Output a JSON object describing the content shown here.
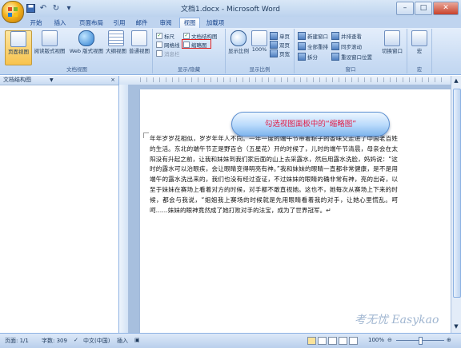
{
  "window": {
    "title": "文档1.docx - Microsoft Word"
  },
  "qat": {
    "save_icon": "save-icon",
    "undo_icon": "undo-icon",
    "redo_icon": "redo-icon",
    "customize": "▾"
  },
  "tabs": [
    {
      "label": "开始",
      "active": false
    },
    {
      "label": "插入",
      "active": false
    },
    {
      "label": "页面布局",
      "active": false
    },
    {
      "label": "引用",
      "active": false
    },
    {
      "label": "邮件",
      "active": false
    },
    {
      "label": "审阅",
      "active": false
    },
    {
      "label": "视图",
      "active": true
    },
    {
      "label": "加载项",
      "active": false
    }
  ],
  "ribbon": {
    "doc_views": {
      "label": "文档视图",
      "buttons": [
        "页面视图",
        "阅读版式视图",
        "Web 版式视图",
        "大纲视图",
        "普通视图"
      ],
      "selected": "页面视图"
    },
    "show_hide": {
      "label": "显示/隐藏",
      "ruler": {
        "label": "标尺",
        "checked": true
      },
      "gridlines": {
        "label": "网格线",
        "checked": false
      },
      "message_bar": {
        "label": "消息栏",
        "checked": false
      },
      "doc_map": {
        "label": "文档结构图",
        "checked": true
      },
      "thumbnails": {
        "label": "缩略图",
        "checked": false
      }
    },
    "zoom": {
      "label": "显示比例",
      "zoom_btn": "显示比例",
      "percent_btn": "100%",
      "one_page": "单页",
      "two_pages": "双页",
      "page_width": "页宽"
    },
    "window": {
      "label": "窗口",
      "new_window": "新建窗口",
      "arrange_all": "全部重排",
      "split": "拆分",
      "side_by_side": "并排查看",
      "sync_scroll": "同步滚动",
      "reset_position": "重设窗口位置",
      "switch_windows": "切换窗口"
    },
    "macros": {
      "label": "宏",
      "button": "宏"
    }
  },
  "map_pane": {
    "title": "文档结构图",
    "close": "×"
  },
  "callout": {
    "text": "勾选视图面板中的“缩略图”"
  },
  "document": {
    "body": "年年岁岁花相似，岁岁年年人不同。一年一度的端午节带着粽子的香味又走进了中国老百姓的生活。东北的端午节正是野百合（五星花）开的时候了，儿时的端午节清晨，母亲会在太阳没有升起之前，让我和妹妹到我们家后面的山上去采露水，然后用露水洗脸，妈妈说：“这时的露水可以治眼疾，会让眼睛变得明亮有神。”我和妹妹的眼睛一直都非常健康，是不是用端午的露水洗出来的，我们也没有经过查证，不过妹妹的眼睛的确非常有神，亮的出奇，以至于妹妹在赛场上看着对方的时候，对手都不敢直视她。这也不，她每次从赛场上下来的时候，都会与我说，“姐姐我上赛场的时候就是先用眼睛看着我的对手，让她心里慌乱。呵呵……妹妹的眼神竟然成了她打败对手的法宝，成为了世界冠军。↵"
  },
  "status": {
    "page": "页面: 1/1",
    "words": "字数: 309",
    "language": "中文(中国)",
    "insert": "插入",
    "zoom": "100%"
  },
  "watermark": "考无忧 Easykao"
}
